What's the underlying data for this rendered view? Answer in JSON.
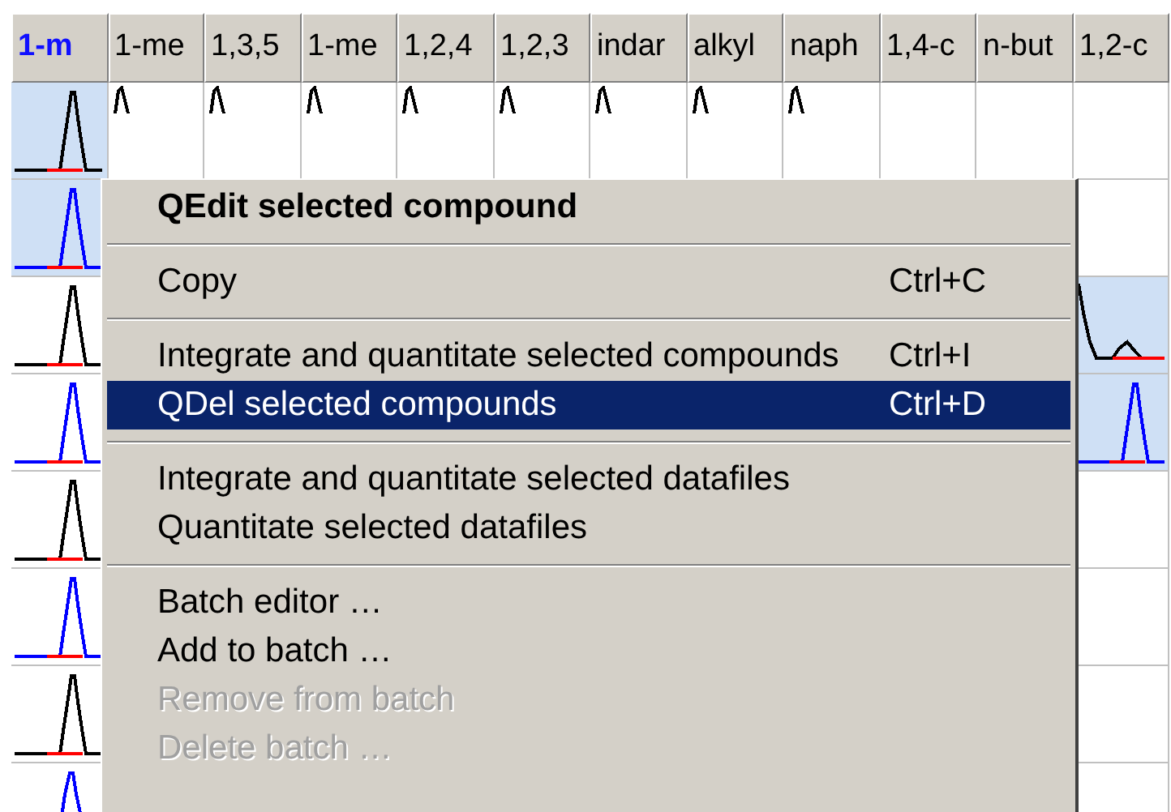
{
  "grid": {
    "columns": [
      {
        "label": "1-m",
        "selected": true
      },
      {
        "label": "1-me",
        "selected": false
      },
      {
        "label": "1,3,5",
        "selected": false
      },
      {
        "label": "1-me",
        "selected": false
      },
      {
        "label": "1,2,4",
        "selected": false
      },
      {
        "label": "1,2,3",
        "selected": false
      },
      {
        "label": "indar",
        "selected": false
      },
      {
        "label": "alkyl",
        "selected": false
      },
      {
        "label": "naph",
        "selected": false
      },
      {
        "label": "1,4-c",
        "selected": false
      },
      {
        "label": "n-but",
        "selected": false
      },
      {
        "label": "1,2-c",
        "selected": false
      }
    ],
    "rows": [
      {
        "cells": [
          {
            "kind": "full",
            "color": "#000000",
            "selected": true
          },
          {
            "kind": "small",
            "color": "#000000",
            "selected": false
          },
          {
            "kind": "small",
            "color": "#000000",
            "selected": false
          },
          {
            "kind": "small",
            "color": "#000000",
            "selected": false
          },
          {
            "kind": "small",
            "color": "#000000",
            "selected": false
          },
          {
            "kind": "small",
            "color": "#000000",
            "selected": false
          },
          {
            "kind": "small",
            "color": "#000000",
            "selected": false
          },
          {
            "kind": "small",
            "color": "#000000",
            "selected": false
          },
          {
            "kind": "small",
            "color": "#000000",
            "selected": false
          },
          {
            "kind": "empty",
            "selected": false
          },
          {
            "kind": "empty",
            "selected": false
          },
          {
            "kind": "empty",
            "selected": false
          }
        ]
      },
      {
        "cells": [
          {
            "kind": "full",
            "color": "#0000ff",
            "selected": true
          },
          null,
          null,
          null,
          null,
          null,
          null,
          null,
          null,
          null,
          null,
          {
            "kind": "empty",
            "selected": false
          }
        ]
      },
      {
        "cells": [
          {
            "kind": "full",
            "color": "#000000",
            "selected": false
          },
          null,
          null,
          null,
          null,
          null,
          null,
          null,
          null,
          null,
          null,
          {
            "kind": "tail",
            "color": "#000000",
            "selected": true
          }
        ]
      },
      {
        "cells": [
          {
            "kind": "full",
            "color": "#0000ff",
            "selected": false
          },
          null,
          null,
          null,
          null,
          null,
          null,
          null,
          null,
          null,
          null,
          {
            "kind": "full",
            "color": "#0000ff",
            "selected": true
          }
        ]
      },
      {
        "cells": [
          {
            "kind": "full",
            "color": "#000000",
            "selected": false
          },
          null,
          null,
          null,
          null,
          null,
          null,
          null,
          null,
          null,
          null,
          {
            "kind": "empty",
            "selected": false
          }
        ]
      },
      {
        "cells": [
          {
            "kind": "full",
            "color": "#0000ff",
            "selected": false
          },
          null,
          null,
          null,
          null,
          null,
          null,
          null,
          null,
          null,
          null,
          {
            "kind": "empty",
            "selected": false
          }
        ]
      },
      {
        "cells": [
          {
            "kind": "full",
            "color": "#000000",
            "selected": false
          },
          null,
          null,
          null,
          null,
          null,
          null,
          null,
          null,
          null,
          null,
          {
            "kind": "empty",
            "selected": false
          }
        ]
      },
      {
        "cells": [
          {
            "kind": "top",
            "color": "#0000ff",
            "selected": false
          },
          null,
          null,
          null,
          null,
          null,
          null,
          null,
          null,
          null,
          null,
          {
            "kind": "empty",
            "selected": false
          }
        ]
      }
    ]
  },
  "context_menu": {
    "items": [
      {
        "kind": "item",
        "label": "QEdit selected compound",
        "default": true,
        "selected": false,
        "disabled": false
      },
      {
        "kind": "separator"
      },
      {
        "kind": "item",
        "label": "Copy",
        "shortcut": "Ctrl+C",
        "default": false,
        "selected": false,
        "disabled": false
      },
      {
        "kind": "separator"
      },
      {
        "kind": "item",
        "label": "Integrate and quantitate selected compounds",
        "shortcut": "Ctrl+I",
        "default": false,
        "selected": false,
        "disabled": false
      },
      {
        "kind": "item",
        "label": "QDel selected compounds",
        "shortcut": "Ctrl+D",
        "default": false,
        "selected": true,
        "disabled": false
      },
      {
        "kind": "separator"
      },
      {
        "kind": "item",
        "label": "Integrate and quantitate selected datafiles",
        "default": false,
        "selected": false,
        "disabled": false
      },
      {
        "kind": "item",
        "label": "Quantitate selected datafiles",
        "default": false,
        "selected": false,
        "disabled": false
      },
      {
        "kind": "separator"
      },
      {
        "kind": "item",
        "label": "Batch editor …",
        "default": false,
        "selected": false,
        "disabled": false
      },
      {
        "kind": "item",
        "label": "Add to batch …",
        "default": false,
        "selected": false,
        "disabled": false
      },
      {
        "kind": "item",
        "label": "Remove from batch",
        "default": false,
        "selected": false,
        "disabled": true
      },
      {
        "kind": "item",
        "label": "Delete batch …",
        "default": false,
        "selected": false,
        "disabled": true
      }
    ]
  }
}
